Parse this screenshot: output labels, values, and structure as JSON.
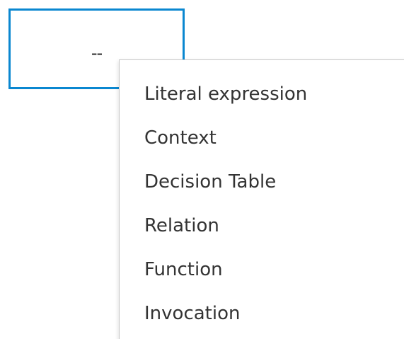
{
  "cell": {
    "value": "--"
  },
  "menu": {
    "items": [
      {
        "label": "Literal expression"
      },
      {
        "label": "Context"
      },
      {
        "label": "Decision Table"
      },
      {
        "label": "Relation"
      },
      {
        "label": "Function"
      },
      {
        "label": "Invocation"
      }
    ]
  },
  "colors": {
    "selection_border": "#0a87d0",
    "menu_border": "#c8c8c8",
    "text": "#333333"
  }
}
